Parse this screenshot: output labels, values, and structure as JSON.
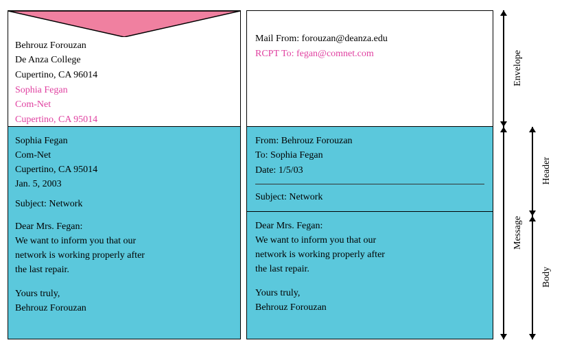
{
  "envelope_left": {
    "sender_line1": "Behrouz Forouzan",
    "sender_line2": "De Anza College",
    "sender_line3": "Cupertino, CA 96014",
    "recipient_line1": "Sophia Fegan",
    "recipient_line2": "Com-Net",
    "recipient_line3": "Cupertino, CA 95014"
  },
  "letter_left": {
    "line1": "Sophia Fegan",
    "line2": "Com-Net",
    "line3": "Cupertino, CA 95014",
    "line4": "Jan. 5, 2003",
    "subject": "Subject: Network",
    "body_line1": "Dear Mrs. Fegan:",
    "body_line2": "We want to inform you that our",
    "body_line3": "network is working properly after",
    "body_line4": "the last repair.",
    "sign1": "Yours truly,",
    "sign2": "Behrouz Forouzan"
  },
  "envelope_right": {
    "mail_from": "Mail From: forouzan@deanza.edu",
    "rcpt_to": "RCPT To: fegan@comnet.com"
  },
  "header_right": {
    "from": "From: Behrouz Forouzan",
    "to": "To: Sophia  Fegan",
    "date": "Date: 1/5/03",
    "subject": "Subject: Network"
  },
  "body_right": {
    "body_line1": "Dear Mrs. Fegan:",
    "body_line2": "We want to inform you that our",
    "body_line3": "network is working properly after",
    "body_line4": "the last repair.",
    "sign1": "Yours truly,",
    "sign2": "Behrouz Forouzan"
  },
  "labels": {
    "envelope": "Envelope",
    "header": "Header",
    "body": "Body",
    "message": "Message"
  }
}
